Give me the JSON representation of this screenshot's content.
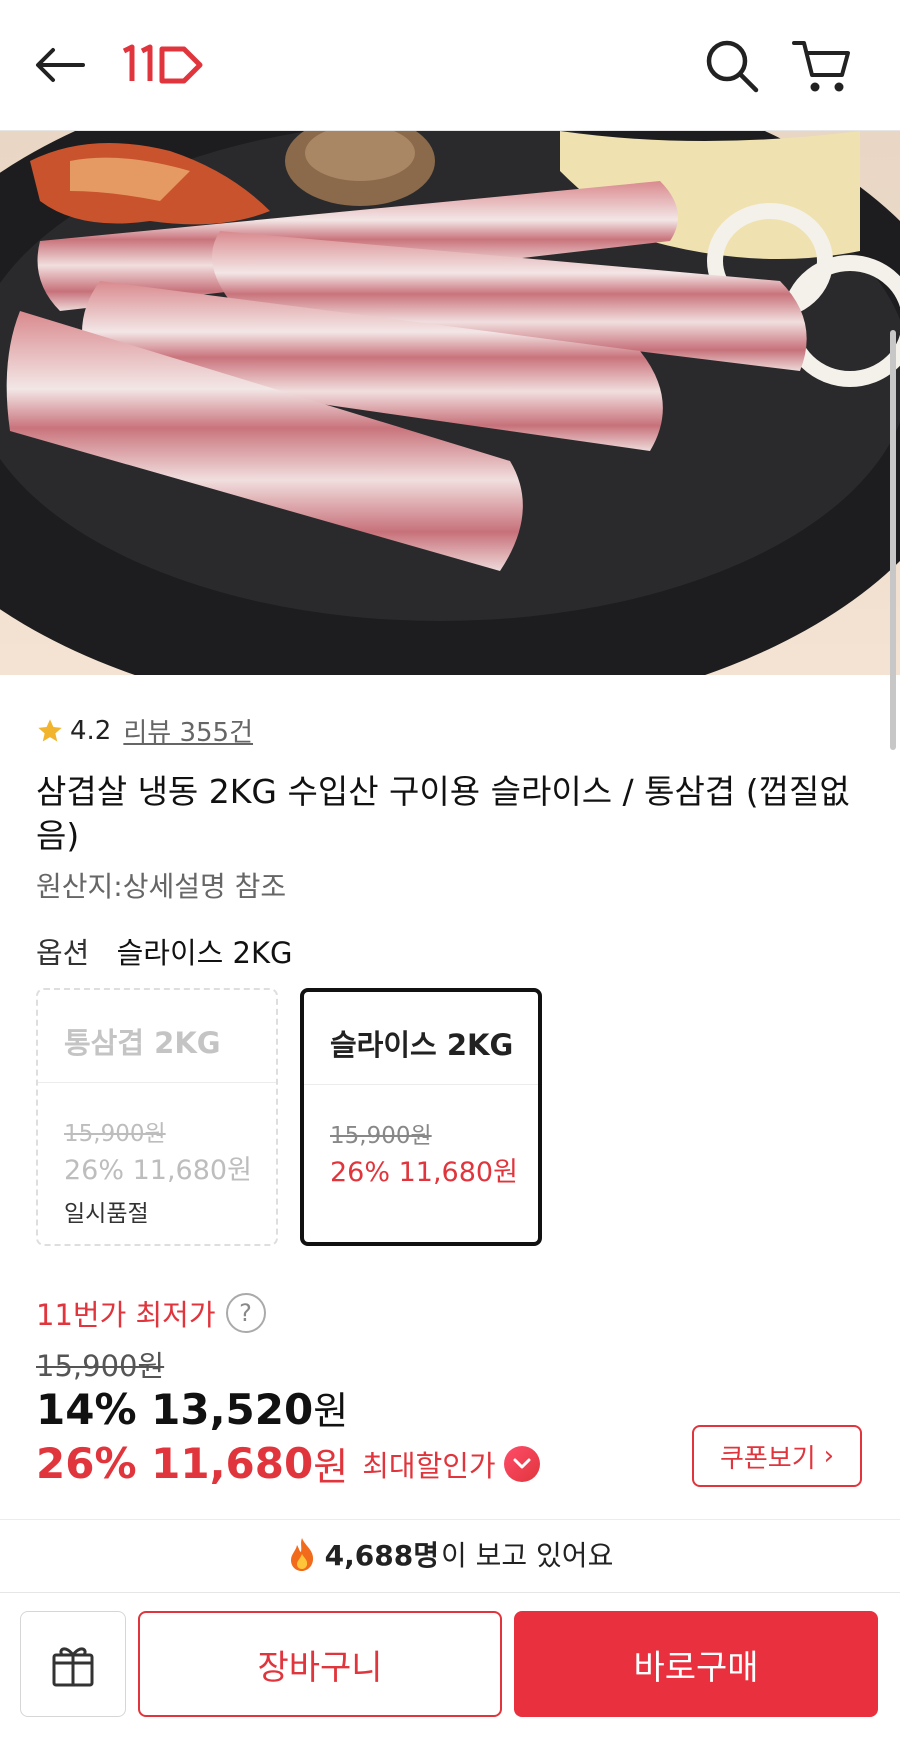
{
  "header": {
    "back_icon": "arrow-left-icon",
    "logo_text": "11",
    "search_icon": "search-icon",
    "cart_icon": "cart-icon"
  },
  "product": {
    "rating": "4.2",
    "reviews_label": "리뷰 355건",
    "title": "삼겹살 냉동 2KG 수입산 구이용 슬라이스 / 통삼겹 (껍질없음)",
    "origin": "원산지:상세설명 참조"
  },
  "option": {
    "label": "옵션",
    "selected": "슬라이스 2KG",
    "cards": [
      {
        "name": "통삼겹 2KG",
        "original_price": "15,900원",
        "sale_price": "26% 11,680원",
        "status": "일시품절"
      },
      {
        "name": "슬라이스 2KG",
        "original_price": "15,900원",
        "sale_price": "26% 11,680원",
        "status": ""
      }
    ]
  },
  "pricing": {
    "lowest_label": "11번가 최저가",
    "help_symbol": "?",
    "original": "15,900원",
    "discount_price": "14% 13,520",
    "discount_won": "원",
    "max_price": "26% 11,680",
    "max_won": "원",
    "max_label": "최대할인가",
    "coupon_button": "쿠폰보기",
    "coupon_chevron": "›"
  },
  "viewers": {
    "count": "4,688명",
    "text": "이 보고 있어요",
    "icon": "fire-icon"
  },
  "bottom": {
    "gift_icon": "gift-icon",
    "cart_button": "장바구니",
    "buy_button": "바로구매"
  },
  "colors": {
    "accent": "#e0353c",
    "buy": "#e8303f"
  }
}
